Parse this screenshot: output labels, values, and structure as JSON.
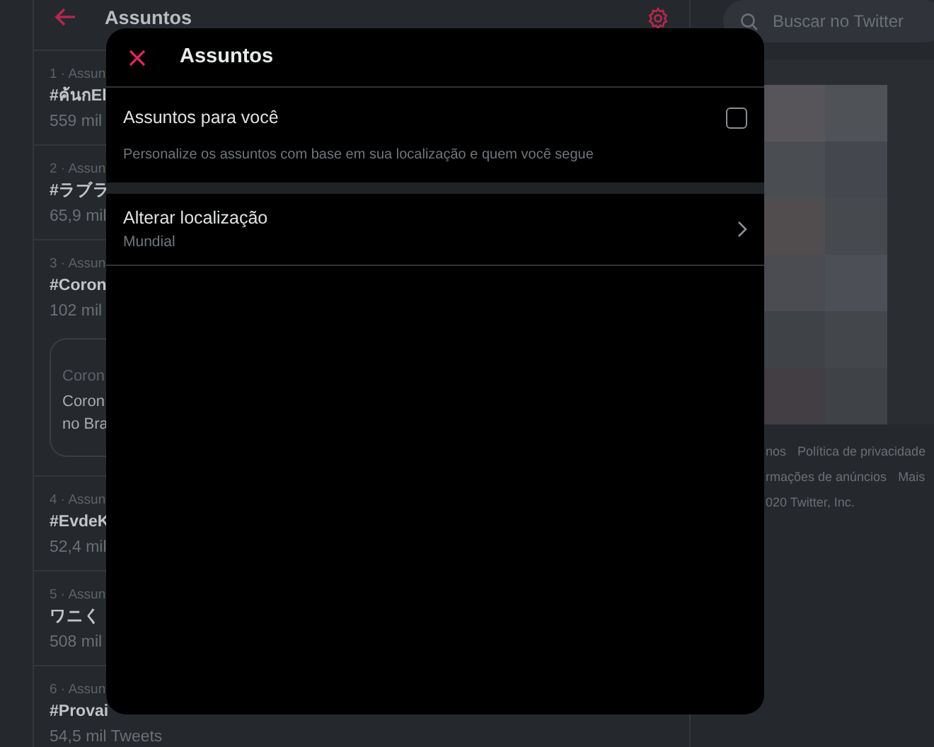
{
  "header": {
    "title": "Assuntos"
  },
  "trends": [
    {
      "meta": "1 · Assun",
      "name": "#ค้นกEl",
      "count": "559 mil"
    },
    {
      "meta": "2 · Assun",
      "name": "#ラブラ",
      "count": "65,9 mil"
    },
    {
      "meta": "3 · Assun",
      "name": "#Coron",
      "count": "102 mil",
      "card": {
        "source": "Coron",
        "lines": [
          "Coron",
          "no Bra"
        ]
      }
    },
    {
      "meta": "4 · Assun",
      "name": "#EvdeK",
      "count": "52,4 mil"
    },
    {
      "meta": "5 · Assun",
      "name": "ワニく",
      "count": "508 mil"
    },
    {
      "meta": "6 · Assun",
      "name": "#Provai",
      "count": "54,5 mil Tweets"
    }
  ],
  "search": {
    "placeholder": "Buscar no Twitter"
  },
  "footer": [
    [
      "nos",
      "Política de privacidade"
    ],
    [
      "rmações de anúncios",
      "Mais"
    ],
    [
      "020 Twitter, Inc."
    ]
  ],
  "modal": {
    "title": "Assuntos",
    "settings": [
      {
        "kind": "toggle",
        "label": "Assuntos para você",
        "description": "Personalize os assuntos com base em sua localização e quem você segue",
        "checked": false
      },
      {
        "kind": "link",
        "label": "Alterar localização",
        "value": "Mundial"
      }
    ]
  }
}
